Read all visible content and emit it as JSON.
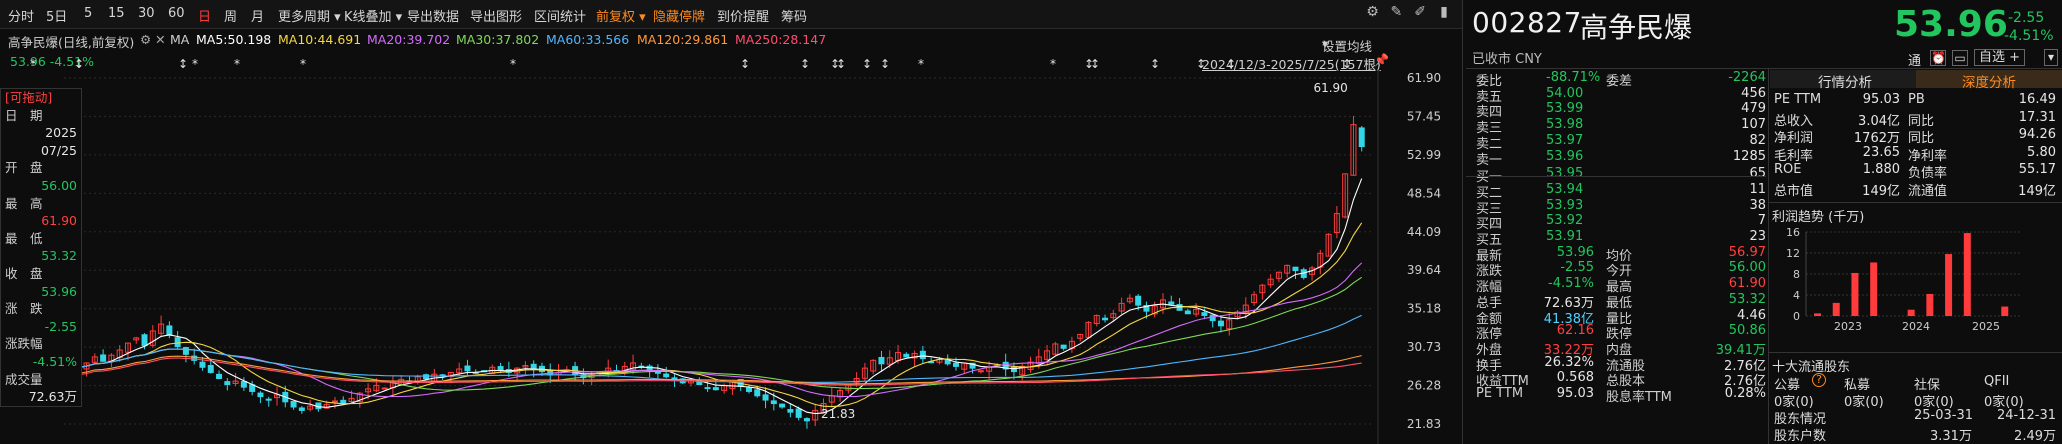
{
  "toolbar": {
    "items": [
      "分时",
      "5日",
      "5",
      "15",
      "30",
      "60",
      "日",
      "周",
      "月",
      "更多周期",
      "K线叠加",
      "导出数据",
      "导出图形",
      "区间统计",
      "前复权",
      "隐藏停牌",
      "到价提醒",
      "筹码"
    ]
  },
  "chart_header": {
    "stock_label": "高争民爆(日线,前复权)",
    "ma_label": "MA",
    "ma5": "MA5:50.198",
    "ma10": "MA10:44.691",
    "ma20": "MA20:39.702",
    "ma30": "MA30:37.802",
    "ma60": "MA60:33.566",
    "ma120": "MA120:29.861",
    "ma250": "MA250:28.147",
    "change_line": "53.96 -4.51%",
    "settings": "设置均线",
    "date_range": "2024/12/3-2025/7/25(157根)"
  },
  "info_panel": {
    "title": "[可拖动]",
    "rows": [
      {
        "label": "日　期",
        "value": "2025"
      },
      {
        "label": "",
        "value": "07/25"
      },
      {
        "label": "开　盘",
        "value": "56.00"
      },
      {
        "label": "最　高",
        "value": "61.90"
      },
      {
        "label": "最　低",
        "value": "53.32"
      },
      {
        "label": "收　盘",
        "value": "53.96"
      },
      {
        "label": "涨　跌",
        "value": "-2.55"
      },
      {
        "label": "涨跌幅",
        "value": "-4.51%"
      },
      {
        "label": "成交量",
        "value": "72.63万"
      }
    ]
  },
  "chart_data": {
    "type": "candlestick",
    "y_ticks": [
      "61.90",
      "57.45",
      "52.99",
      "48.54",
      "44.09",
      "39.64",
      "35.18",
      "30.73",
      "26.28",
      "21.83"
    ],
    "ylim": [
      21.83,
      61.9
    ],
    "high_label": "61.90",
    "low_label": "21.83",
    "ma_colors": {
      "ma5": "#ffffff",
      "ma10": "#f5d742",
      "ma20": "#d36bff",
      "ma30": "#7ed957",
      "ma60": "#4fb6ff",
      "ma120": "#ff9a3c",
      "ma250": "#ff4d6d"
    },
    "closes": [
      28.5,
      28.2,
      28.9,
      29.6,
      29.1,
      29.8,
      30.4,
      31.2,
      31.8,
      30.9,
      32.6,
      33.4,
      32.1,
      30.8,
      29.9,
      29.2,
      28.4,
      27.8,
      27.1,
      26.4,
      26.8,
      26.1,
      25.6,
      25.0,
      24.6,
      25.2,
      24.4,
      23.8,
      23.4,
      23.9,
      23.6,
      24.1,
      24.5,
      24.2,
      24.8,
      25.4,
      25.9,
      26.3,
      26.0,
      26.6,
      27.0,
      26.8,
      27.3,
      27.1,
      27.6,
      27.4,
      27.8,
      28.2,
      28.0,
      27.7,
      27.9,
      28.4,
      28.1,
      27.8,
      28.3,
      28.6,
      28.2,
      27.9,
      27.5,
      27.8,
      28.1,
      27.6,
      27.2,
      27.5,
      27.9,
      28.3,
      28.0,
      28.5,
      28.9,
      28.4,
      28.0,
      27.7,
      27.3,
      27.0,
      26.6,
      26.9,
      26.4,
      26.0,
      25.8,
      26.3,
      26.7,
      26.2,
      25.6,
      25.1,
      24.6,
      24.2,
      23.8,
      23.2,
      22.6,
      22.2,
      23.4,
      24.2,
      25.1,
      25.7,
      26.4,
      27.1,
      28.3,
      29.2,
      28.8,
      29.5,
      30.1,
      29.6,
      30.0,
      29.4,
      29.0,
      29.3,
      28.8,
      28.5,
      28.9,
      28.3,
      28.0,
      28.4,
      28.7,
      28.2,
      27.9,
      28.5,
      29.0,
      29.6,
      30.3,
      31.1,
      30.6,
      31.4,
      32.2,
      33.6,
      34.4,
      33.9,
      34.6,
      35.8,
      36.4,
      35.6,
      34.9,
      35.5,
      36.2,
      35.7,
      35.0,
      34.6,
      35.1,
      34.4,
      33.8,
      33.2,
      33.9,
      34.8,
      35.6,
      36.8,
      37.9,
      38.6,
      39.4,
      40.2,
      39.6,
      38.8,
      39.9,
      41.6,
      43.8,
      46.2,
      50.8,
      56.5,
      53.96
    ]
  },
  "quote": {
    "code": "002827",
    "name": "高争民爆",
    "status": "已收市 CNY",
    "price": "53.96",
    "change": "-2.55",
    "pct": "-4.51%",
    "tag": "通",
    "watchlist": "自选 +"
  },
  "order_book": {
    "weibi_label": "委比",
    "weibi": "-88.71%",
    "weicha_label": "委差",
    "weicha": "-2264",
    "asks": [
      {
        "label": "卖五",
        "price": "54.00",
        "vol": "456"
      },
      {
        "label": "卖四",
        "price": "53.99",
        "vol": "479"
      },
      {
        "label": "卖三",
        "price": "53.98",
        "vol": "107"
      },
      {
        "label": "卖二",
        "price": "53.97",
        "vol": "82"
      },
      {
        "label": "卖一",
        "price": "53.96",
        "vol": "1285"
      }
    ],
    "bids": [
      {
        "label": "买一",
        "price": "53.95",
        "vol": "65"
      },
      {
        "label": "买二",
        "price": "53.94",
        "vol": "11"
      },
      {
        "label": "买三",
        "price": "53.93",
        "vol": "38"
      },
      {
        "label": "买四",
        "price": "53.92",
        "vol": "7"
      },
      {
        "label": "买五",
        "price": "53.91",
        "vol": "23"
      }
    ]
  },
  "stats": [
    {
      "l1": "最新",
      "v1": "53.96",
      "l2": "均价",
      "v2": "56.97"
    },
    {
      "l1": "涨跌",
      "v1": "-2.55",
      "l2": "今开",
      "v2": "56.00"
    },
    {
      "l1": "涨幅",
      "v1": "-4.51%",
      "l2": "最高",
      "v2": "61.90"
    },
    {
      "l1": "总手",
      "v1": "72.63万",
      "l2": "最低",
      "v2": "53.32"
    },
    {
      "l1": "金额",
      "v1": "41.38亿",
      "l2": "量比",
      "v2": "4.46"
    },
    {
      "l1": "涨停",
      "v1": "62.16",
      "l2": "跌停",
      "v2": "50.86"
    },
    {
      "l1": "外盘",
      "v1": "33.22万",
      "l2": "内盘",
      "v2": "39.41万"
    },
    {
      "l1": "换手",
      "v1": "26.32%",
      "l2": "流通股",
      "v2": "2.76亿"
    },
    {
      "l1": "收益TTM",
      "v1": "0.568",
      "l2": "总股本",
      "v2": "2.76亿"
    },
    {
      "l1": "PE TTM",
      "v1": "95.03",
      "l2": "股息率TTM",
      "v2": "0.28%"
    }
  ],
  "analysis": {
    "tab1": "行情分析",
    "tab2": "深度分析",
    "rows": [
      {
        "l1": "PE TTM",
        "v1": "95.03",
        "l2": "PB",
        "v2": "16.49"
      },
      {
        "l1": "总收入",
        "v1": "3.04亿",
        "l2": "同比",
        "v2": "17.31"
      },
      {
        "l1": "净利润",
        "v1": "1762万",
        "l2": "同比",
        "v2": "94.26"
      },
      {
        "l1": "毛利率",
        "v1": "23.65",
        "l2": "净利率",
        "v2": "5.80"
      },
      {
        "l1": "ROE",
        "v1": "1.880",
        "l2": "负债率",
        "v2": "55.17"
      },
      {
        "l1": "总市值",
        "v1": "149亿",
        "l2": "流通值",
        "v2": "149亿"
      }
    ],
    "profit_title": "利润趋势 (千万)",
    "profit_chart": {
      "type": "bar",
      "y_ticks": [
        "16",
        "12",
        "8",
        "4",
        "0"
      ],
      "ylim": [
        0,
        16
      ],
      "x_labels": [
        "2023",
        "2024",
        "2025"
      ],
      "values": [
        0.5,
        2.5,
        8.2,
        10.2,
        0,
        1.2,
        4.2,
        11.8,
        15.8,
        0,
        1.8
      ]
    },
    "holders_title": "十大流通股东",
    "holder_cols": [
      "公募",
      "私募",
      "社保",
      "QFII"
    ],
    "holder_vals": [
      "0家(0)",
      "0家(0)",
      "0家(0)",
      "0家(0)"
    ],
    "holder_info_label": "股东情况",
    "holder_dates": [
      "25-03-31",
      "24-12-31"
    ],
    "holder_count_label": "股东户数",
    "holder_counts": [
      "3.31万",
      "2.49万"
    ]
  }
}
